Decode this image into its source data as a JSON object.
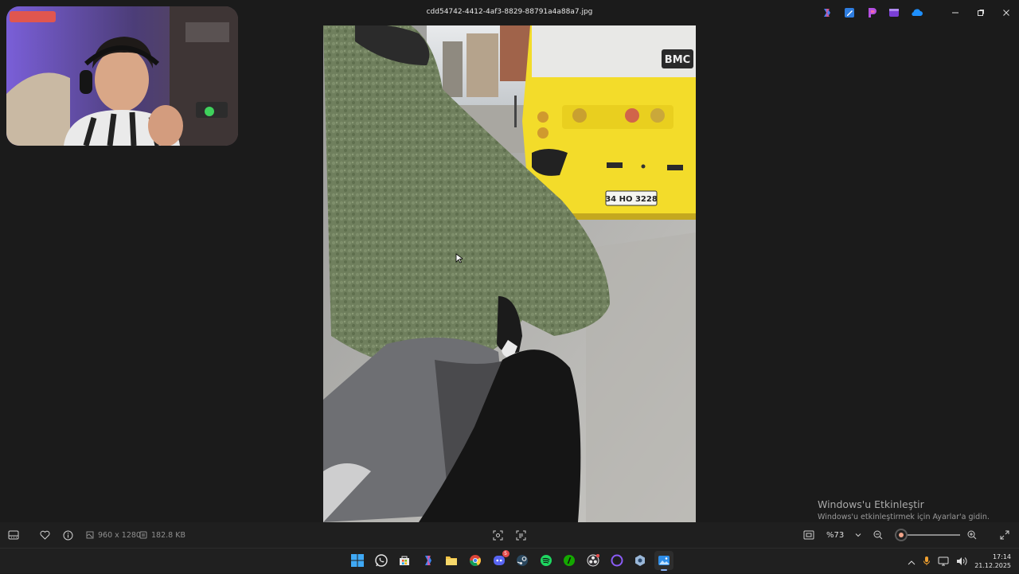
{
  "window": {
    "title": "cdd54742-4412-4af3-8829-88791a4a88a7.jpg"
  },
  "photo": {
    "plate_text": "34 HO 3228",
    "bus_logo_text": "BMC"
  },
  "activation": {
    "title": "Windows'u Etkinleştir",
    "subtitle": "Windows'u etkinleştirmek için Ayarlar'a gidin."
  },
  "viewer_bar": {
    "dimensions": "960 x 1280",
    "file_size": "182.8 KB",
    "zoom_value": "%73",
    "zoom_slider_level_percent": 10
  },
  "taskbar": {
    "apps": [
      {
        "name": "start-menu-icon"
      },
      {
        "name": "whatsapp-icon"
      },
      {
        "name": "microsoft-store-icon"
      },
      {
        "name": "copilot-icon"
      },
      {
        "name": "file-explorer-icon"
      },
      {
        "name": "chrome-icon"
      },
      {
        "name": "discord-icon",
        "badge": "5"
      },
      {
        "name": "steam-icon"
      },
      {
        "name": "spotify-icon"
      },
      {
        "name": "upwork-icon"
      },
      {
        "name": "obs-icon"
      },
      {
        "name": "proton-icon"
      },
      {
        "name": "settings-app-icon"
      },
      {
        "name": "photos-icon",
        "active": true
      }
    ],
    "clock_time": "17:14",
    "clock_date": "21.12.2025"
  },
  "colors": {
    "accent": "#f0a48a",
    "background": "#1b1b1b",
    "bus_yellow": "#f3dc2a",
    "jacket_green": "#6d7d5b"
  }
}
